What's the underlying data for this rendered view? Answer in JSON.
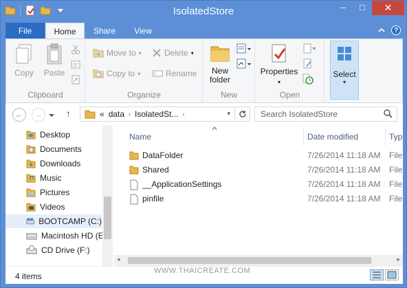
{
  "window": {
    "title": "IsolatedStore",
    "controls": {
      "minimize": "–",
      "maximize": "□",
      "close": "✕"
    }
  },
  "ribbon_tabs": [
    "File",
    "Home",
    "Share",
    "View"
  ],
  "ribbon": {
    "clipboard": {
      "copy": "Copy",
      "paste": "Paste",
      "label": "Clipboard"
    },
    "organize": {
      "move_to": "Move to",
      "copy_to": "Copy to",
      "delete": "Delete",
      "rename": "Rename",
      "label": "Organize"
    },
    "new": {
      "new_folder_line1": "New",
      "new_folder_line2": "folder",
      "label": "New"
    },
    "open": {
      "properties": "Properties",
      "label": "Open"
    },
    "select": {
      "label": "Select"
    }
  },
  "address": {
    "overflow": "«",
    "segments": [
      "data",
      "IsolatedSt..."
    ],
    "search_placeholder": "Search IsolatedStore"
  },
  "nav_pane": [
    {
      "label": "Desktop",
      "icon": "desktop-icon"
    },
    {
      "label": "Documents",
      "icon": "documents-icon"
    },
    {
      "label": "Downloads",
      "icon": "downloads-icon"
    },
    {
      "label": "Music",
      "icon": "music-icon"
    },
    {
      "label": "Pictures",
      "icon": "pictures-icon"
    },
    {
      "label": "Videos",
      "icon": "videos-icon"
    },
    {
      "label": "BOOTCAMP (C:)",
      "icon": "drive-icon",
      "selected": true
    },
    {
      "label": "Macintosh HD (E",
      "icon": "drive-icon"
    },
    {
      "label": "CD Drive (F:)",
      "icon": "cd-drive-icon"
    }
  ],
  "columns": {
    "name": "Name",
    "date": "Date modified",
    "type": "Typ"
  },
  "files": [
    {
      "name": "DataFolder",
      "date": "7/26/2014 11:18 AM",
      "type": "File",
      "kind": "folder"
    },
    {
      "name": "Shared",
      "date": "7/26/2014 11:18 AM",
      "type": "File",
      "kind": "folder"
    },
    {
      "name": "__ApplicationSettings",
      "date": "7/26/2014 11:18 AM",
      "type": "File",
      "kind": "file"
    },
    {
      "name": "pinfile",
      "date": "7/26/2014 11:18 AM",
      "type": "File",
      "kind": "file"
    }
  ],
  "watermark": "WWW.THAICREATE.COM",
  "status": {
    "item_count": "4 items"
  },
  "colors": {
    "title_bar": "#5c8fd6",
    "file_tab": "#2b6cc4",
    "close": "#c7473c",
    "folder": "#e8b84a"
  }
}
